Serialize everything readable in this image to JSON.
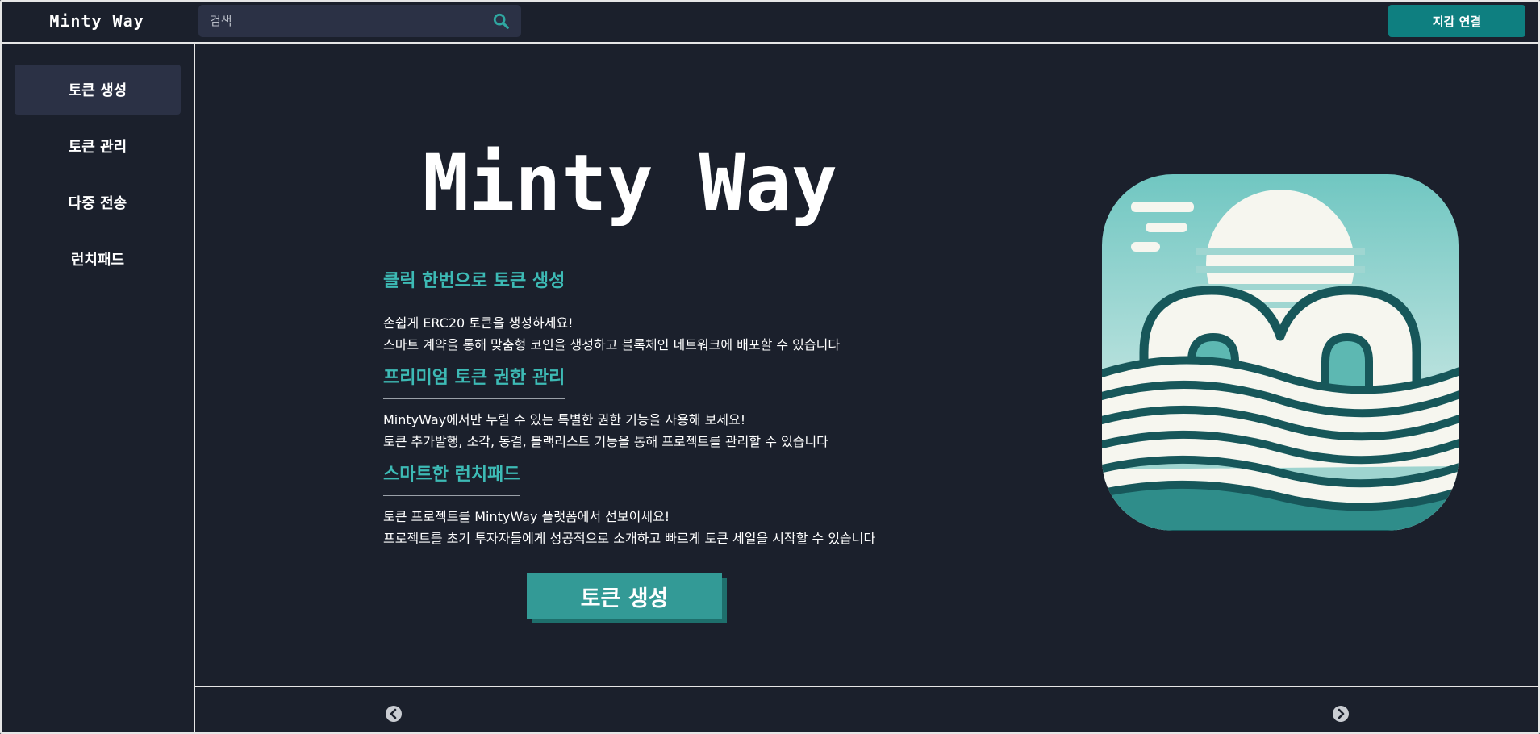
{
  "header": {
    "brand": "Minty Way",
    "search_placeholder": "검색",
    "search_icon": "search-icon",
    "wallet_button": "지갑 연결"
  },
  "sidebar": {
    "items": [
      {
        "label": "토큰 생성",
        "active": true
      },
      {
        "label": "토큰 관리",
        "active": false
      },
      {
        "label": "다중 전송",
        "active": false
      },
      {
        "label": "런치패드",
        "active": false
      }
    ]
  },
  "main": {
    "hero_title": "Minty Way",
    "sections": [
      {
        "title": "클릭 한번으로 토큰 생성",
        "lines": [
          "손쉽게 ERC20 토큰을 생성하세요!",
          "스마트 계약을 통해 맞춤형 코인을 생성하고 블록체인 네트워크에 배포할 수 있습니다"
        ]
      },
      {
        "title": "프리미엄 토큰 권한 관리",
        "lines": [
          "MintyWay에서만 누릴 수 있는 특별한 권한 기능을 사용해 보세요!",
          "토큰 추가발행, 소각, 동결, 블랙리스트 기능을 통해 프로젝트를 관리할 수 있습니다"
        ]
      },
      {
        "title": "스마트한 런치패드",
        "lines": [
          "토큰 프로젝트를 MintyWay 플랫폼에서 선보이세요!",
          "프로젝트를 초기 투자자들에게 성공적으로 소개하고 빠르게 토큰 세일을 시작할 수 있습니다"
        ]
      }
    ],
    "cta_button": "토큰 생성",
    "app_icon": "minty-way-logo-icon"
  },
  "carousel": {
    "prev_icon": "chevron-left-icon",
    "next_icon": "chevron-right-icon"
  },
  "colors": {
    "background": "#1b202c",
    "panel": "#2b3145",
    "accent": "#0e7f80",
    "section_title": "#3dbab5",
    "cta": "#339a96"
  }
}
